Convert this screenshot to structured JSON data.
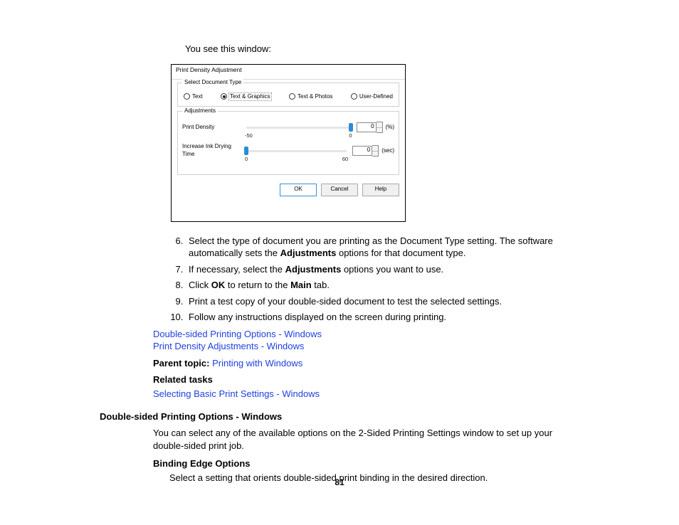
{
  "lead": "You see this window:",
  "dialog": {
    "title": "Print Density Adjustment",
    "doctype_group": "Select Document Type",
    "radios": {
      "text": "Text",
      "text_graphics": "Text & Graphics",
      "text_photos": "Text & Photos",
      "user_defined": "User-Defined"
    },
    "adjust_group": "Adjustments",
    "slider1": {
      "label": "Print Density",
      "min": "-50",
      "max": "0",
      "value": "0",
      "unit": "(%)"
    },
    "slider2": {
      "label": "Increase Ink Drying Time",
      "min": "0",
      "max": "60",
      "value": "0",
      "unit": "(sec)"
    },
    "ok": "OK",
    "cancel": "Cancel",
    "help": "Help"
  },
  "steps": {
    "s6a": "Select the type of document you are printing as the Document Type setting. The software automatically sets the ",
    "s6b": "Adjustments",
    "s6c": " options for that document type.",
    "s7a": "If necessary, select the ",
    "s7b": "Adjustments",
    "s7c": " options you want to use.",
    "s8a": "Click ",
    "s8b": "OK",
    "s8c": " to return to the ",
    "s8d": "Main",
    "s8e": " tab.",
    "s9": "Print a test copy of your double-sided document to test the selected settings.",
    "s10": "Follow any instructions displayed on the screen during printing."
  },
  "links": {
    "l1": "Double-sided Printing Options - Windows",
    "l2": "Print Density Adjustments - Windows"
  },
  "parent_label": "Parent topic: ",
  "parent_link": "Printing with Windows",
  "related_tasks_label": "Related tasks",
  "related_task_link": "Selecting Basic Print Settings - Windows",
  "h2": "Double-sided Printing Options - Windows",
  "body1": "You can select any of the available options on the 2-Sided Printing Settings window to set up your double-sided print job.",
  "sub_h": "Binding Edge Options",
  "sub_body": "Select a setting that orients double-sided print binding in the desired direction.",
  "pagenum": "81"
}
